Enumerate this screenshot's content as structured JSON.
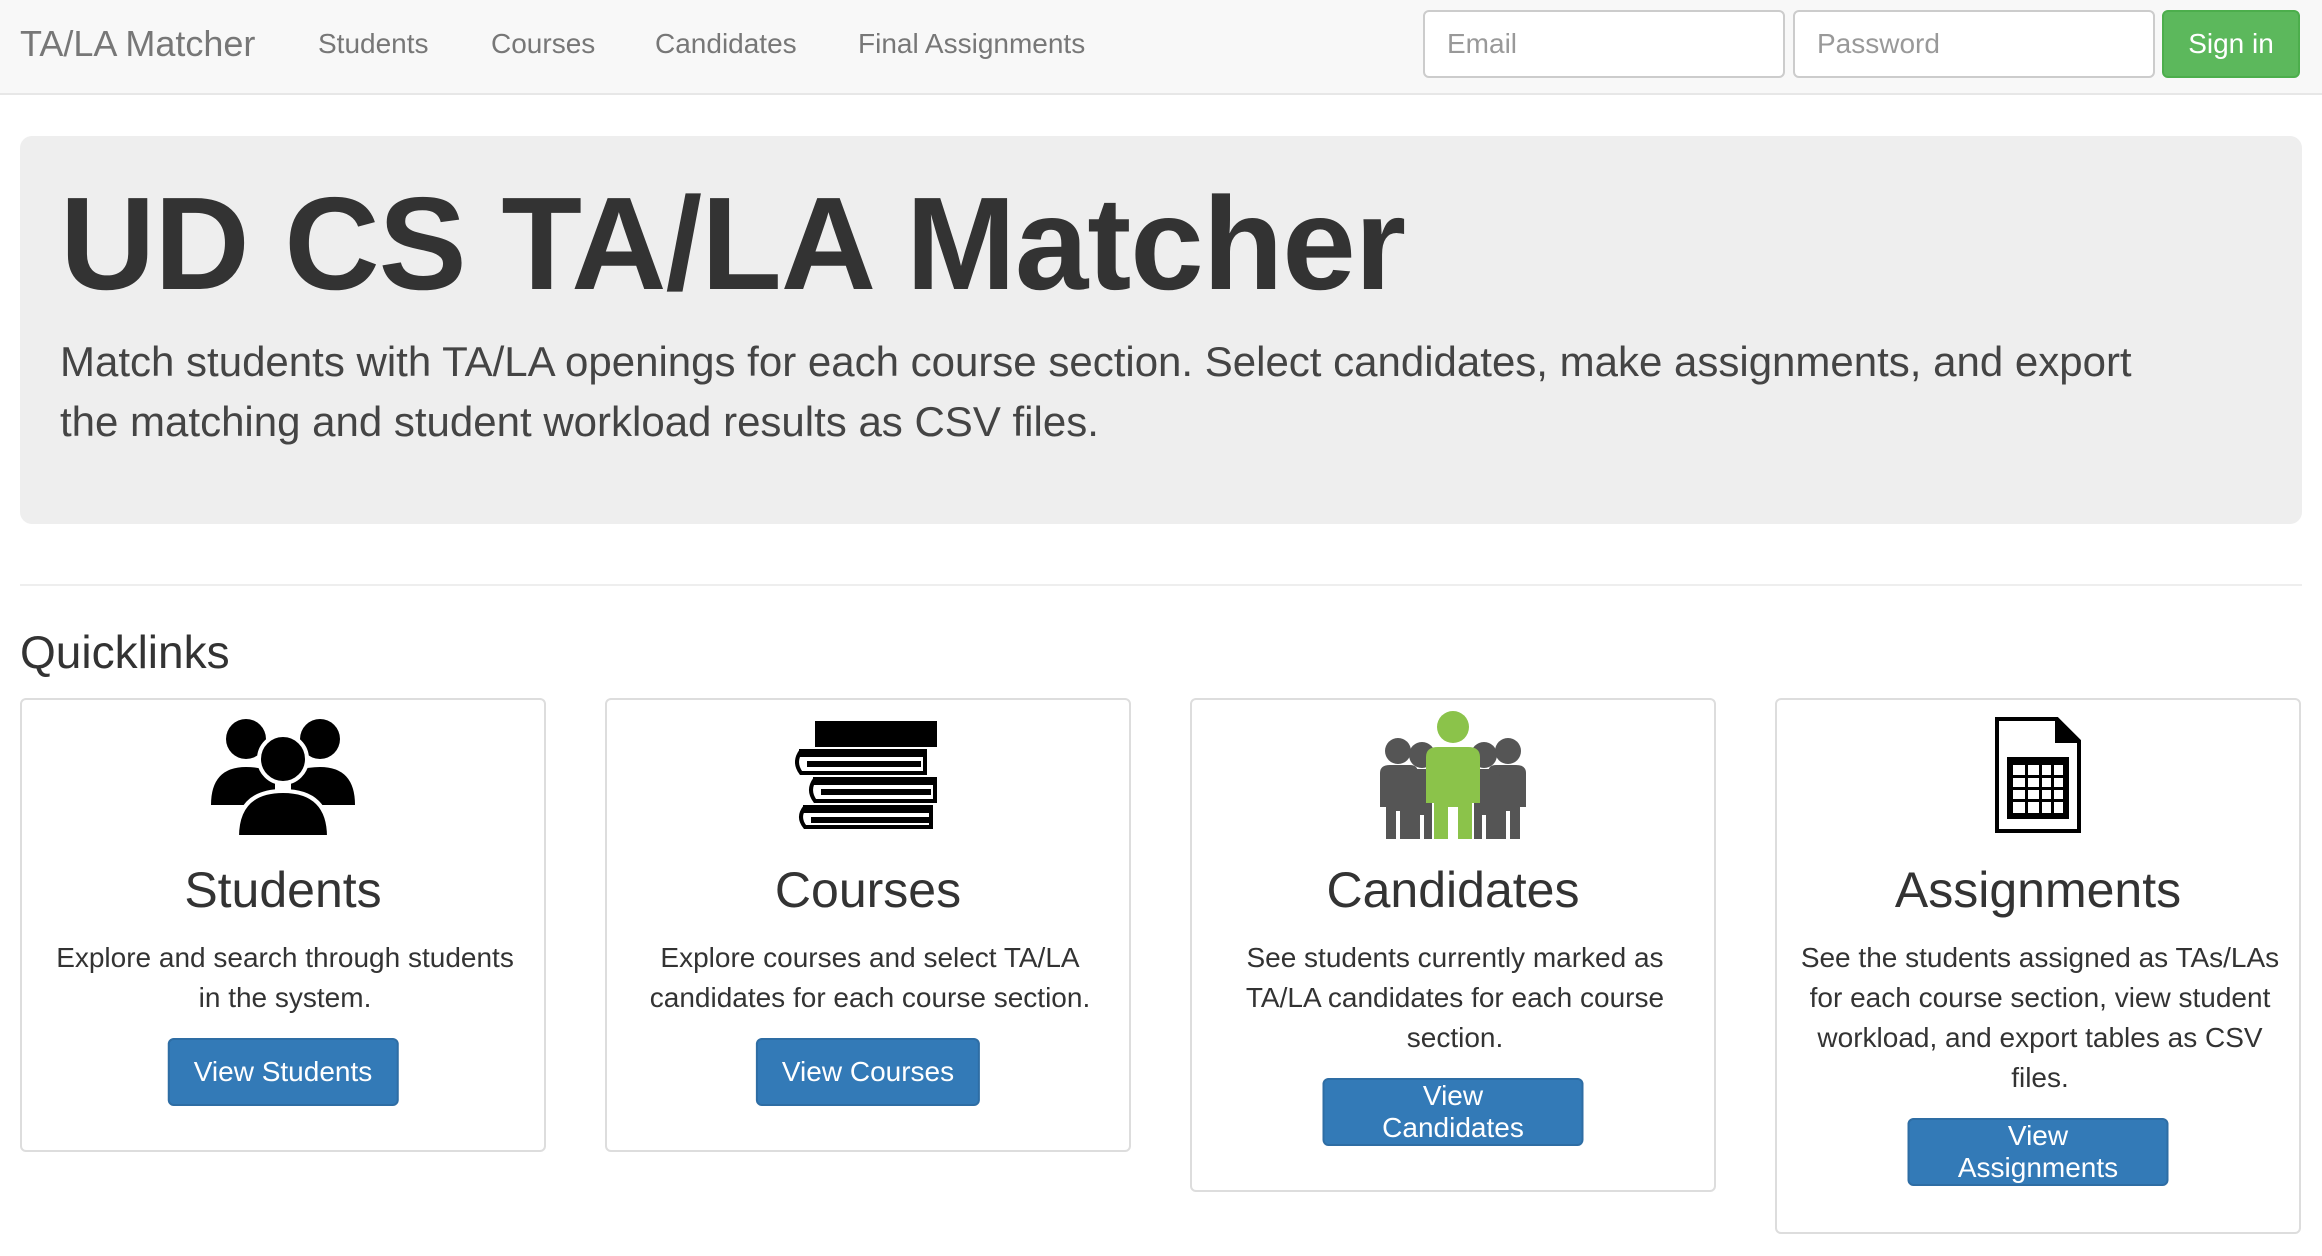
{
  "navbar": {
    "brand": "TA/LA Matcher",
    "links": [
      "Students",
      "Courses",
      "Candidates",
      "Final Assignments"
    ],
    "email_placeholder": "Email",
    "password_placeholder": "Password",
    "signin_label": "Sign in"
  },
  "jumbotron": {
    "title": "UD CS TA/LA Matcher",
    "lead": "Match students with TA/LA openings for each course section. Select candidates, make assignments, and export the matching and student workload results as CSV files."
  },
  "quicklinks": {
    "heading": "Quicklinks",
    "cards": [
      {
        "icon": "users-group-icon",
        "title": "Students",
        "description": "Explore and search through students in the system.",
        "button": "View Students"
      },
      {
        "icon": "books-stack-icon",
        "title": "Courses",
        "description": "Explore courses and select TA/LA candidates for each course section.",
        "button": "View Courses"
      },
      {
        "icon": "candidate-people-icon",
        "title": "Candidates",
        "description": "See students currently marked as TA/LA candidates for each course section.",
        "button": "View Candidates"
      },
      {
        "icon": "spreadsheet-file-icon",
        "title": "Assignments",
        "description": "See the students assigned as TAs/LAs for each course section, view student workload, and export tables as CSV files.",
        "button": "View Assignments"
      }
    ]
  },
  "colors": {
    "primary_button": "#337ab7",
    "success_button": "#5cb85c",
    "candidate_highlight": "#8bc34a",
    "jumbotron_bg": "#eeeeee"
  }
}
